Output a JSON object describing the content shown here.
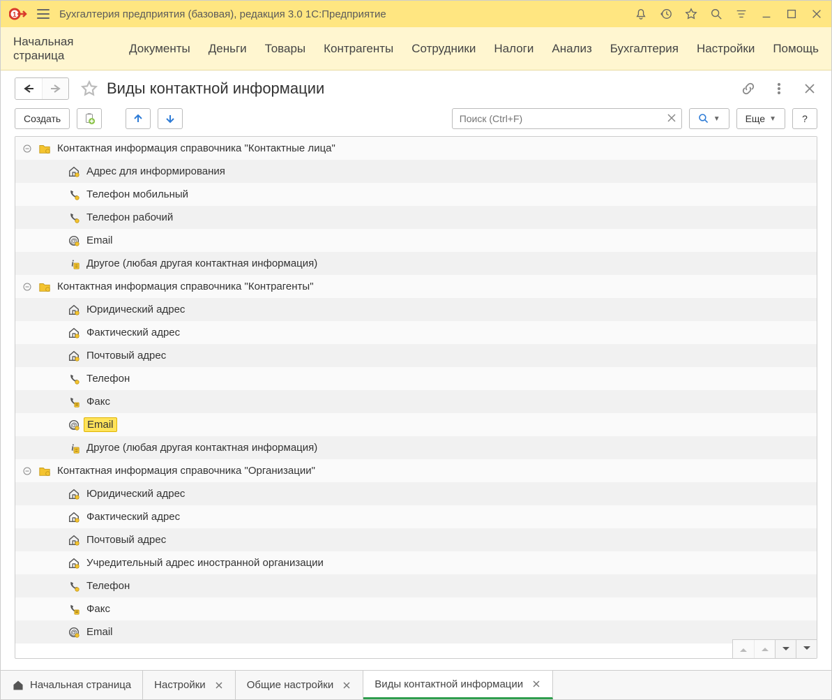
{
  "titlebar": {
    "title": "Бухгалтерия предприятия (базовая), редакция 3.0 1С:Предприятие"
  },
  "menubar": {
    "items": [
      "Начальная страница",
      "Документы",
      "Деньги",
      "Товары",
      "Контрагенты",
      "Сотрудники",
      "Налоги",
      "Анализ",
      "Бухгалтерия",
      "Настройки",
      "Помощь"
    ]
  },
  "page": {
    "title": "Виды контактной информации"
  },
  "toolbar": {
    "create_label": "Создать",
    "search_placeholder": "Поиск (Ctrl+F)",
    "more_label": "Еще",
    "help_label": "?"
  },
  "tree": {
    "groups": [
      {
        "label": "Контактная информация справочника \"Контактные лица\"",
        "items": [
          {
            "icon": "address",
            "label": "Адрес для информирования",
            "selected": false
          },
          {
            "icon": "phone",
            "label": "Телефон мобильный",
            "selected": false
          },
          {
            "icon": "phone",
            "label": "Телефон рабочий",
            "selected": false
          },
          {
            "icon": "email",
            "label": "Email",
            "selected": false
          },
          {
            "icon": "info",
            "label": "Другое (любая другая контактная информация)",
            "selected": false
          }
        ]
      },
      {
        "label": "Контактная информация справочника \"Контрагенты\"",
        "items": [
          {
            "icon": "address",
            "label": "Юридический адрес",
            "selected": false
          },
          {
            "icon": "address",
            "label": "Фактический адрес",
            "selected": false
          },
          {
            "icon": "address",
            "label": "Почтовый адрес",
            "selected": false
          },
          {
            "icon": "phone",
            "label": "Телефон",
            "selected": false
          },
          {
            "icon": "fax",
            "label": "Факс",
            "selected": false
          },
          {
            "icon": "email",
            "label": "Email",
            "selected": true
          },
          {
            "icon": "info",
            "label": "Другое (любая другая контактная информация)",
            "selected": false
          }
        ]
      },
      {
        "label": "Контактная информация справочника \"Организации\"",
        "items": [
          {
            "icon": "address",
            "label": "Юридический адрес",
            "selected": false
          },
          {
            "icon": "address",
            "label": "Фактический адрес",
            "selected": false
          },
          {
            "icon": "address",
            "label": "Почтовый адрес",
            "selected": false
          },
          {
            "icon": "address",
            "label": "Учредительный адрес иностранной организации",
            "selected": false
          },
          {
            "icon": "phone",
            "label": "Телефон",
            "selected": false
          },
          {
            "icon": "fax",
            "label": "Факс",
            "selected": false
          },
          {
            "icon": "email",
            "label": "Email",
            "selected": false
          }
        ]
      }
    ]
  },
  "bottom_tabs": [
    {
      "kind": "home",
      "label": "Начальная страница",
      "closable": false,
      "active": false
    },
    {
      "kind": "normal",
      "label": "Настройки",
      "closable": true,
      "active": false
    },
    {
      "kind": "normal",
      "label": "Общие настройки",
      "closable": true,
      "active": false
    },
    {
      "kind": "normal",
      "label": "Виды контактной информации",
      "closable": true,
      "active": true
    }
  ]
}
